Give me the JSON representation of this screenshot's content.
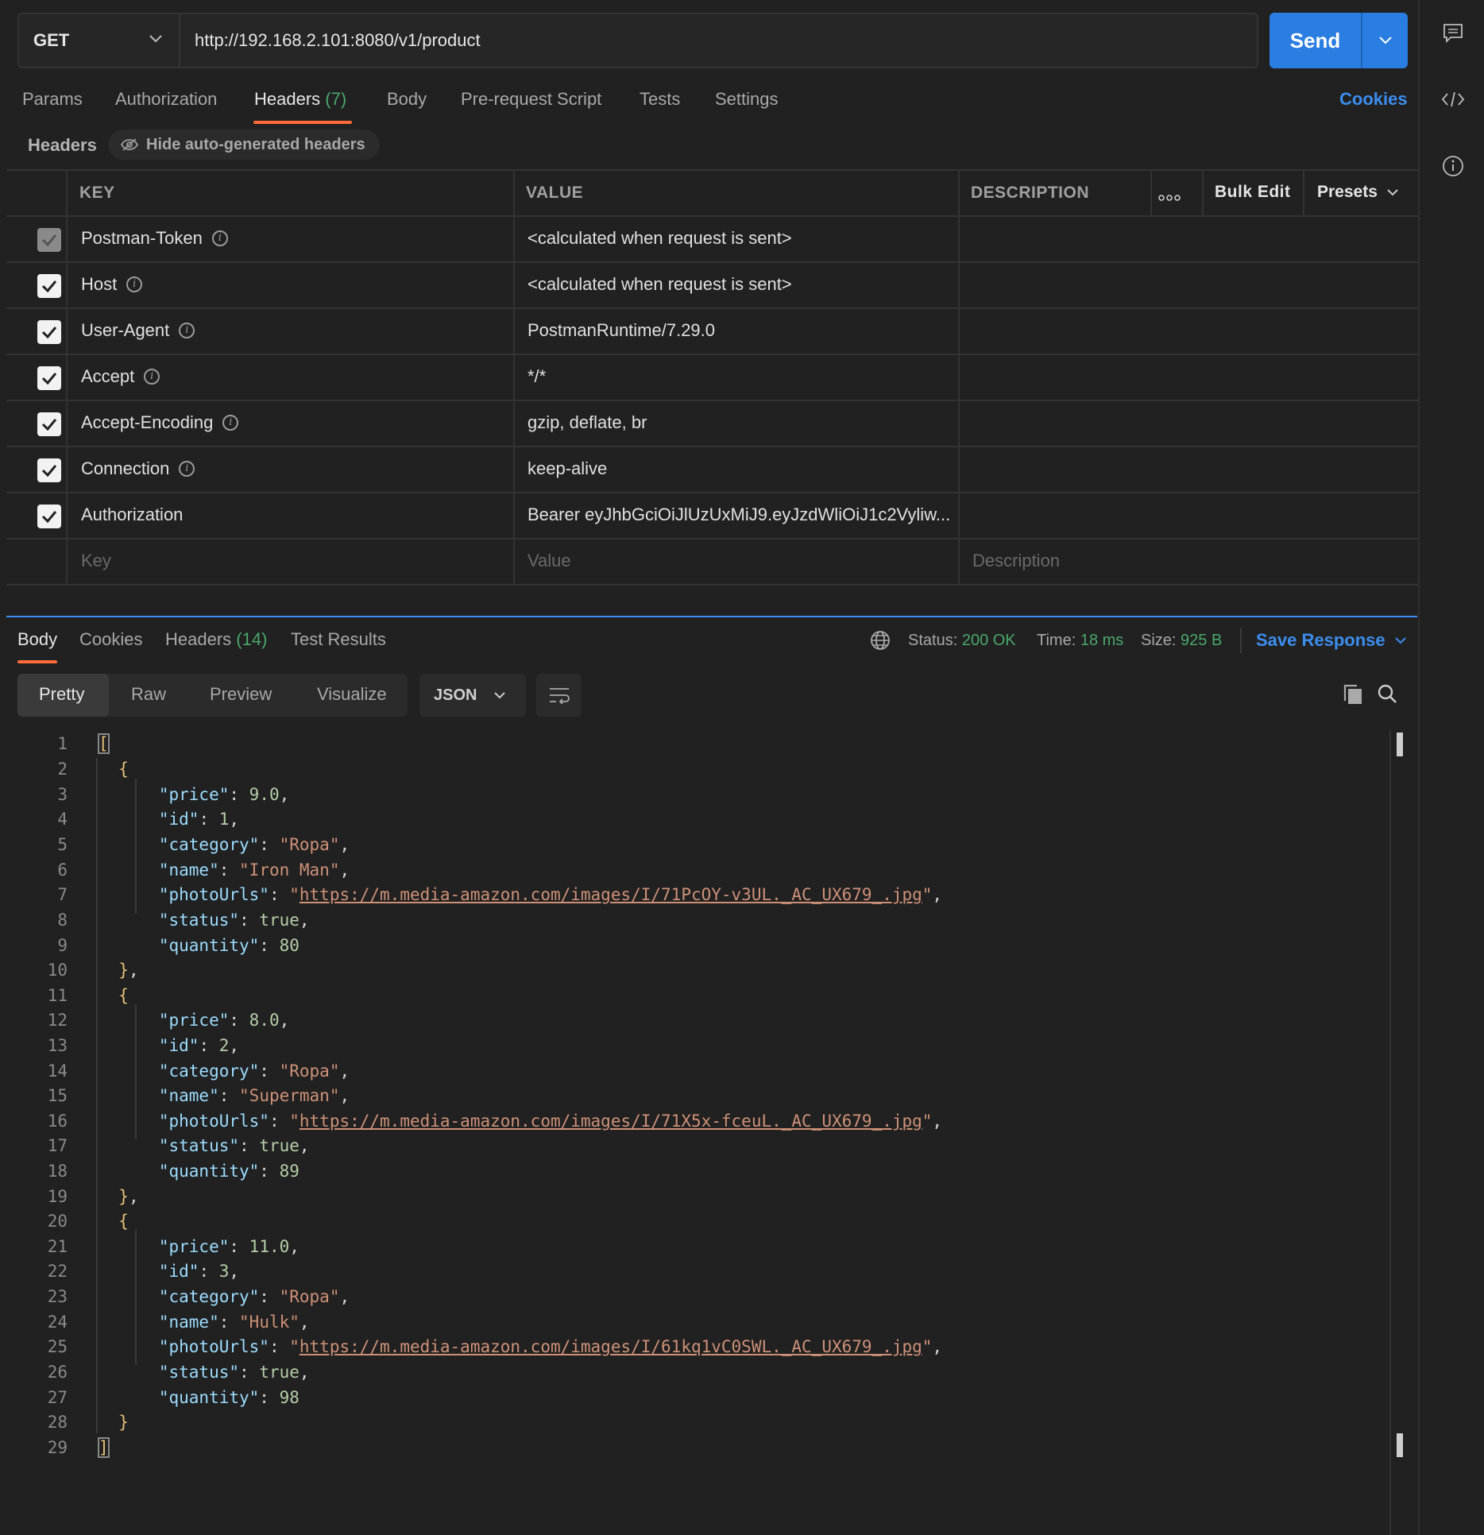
{
  "request": {
    "method": "GET",
    "url": "http://192.168.2.101:8080/v1/product",
    "send_label": "Send"
  },
  "request_tabs": {
    "params": "Params",
    "authorization": "Authorization",
    "headers": "Headers",
    "headers_count": "(7)",
    "body": "Body",
    "prerequest": "Pre-request Script",
    "tests": "Tests",
    "settings": "Settings",
    "cookies": "Cookies"
  },
  "headers_section": {
    "title": "Headers",
    "hide_auto": "Hide auto-generated headers",
    "col_key": "KEY",
    "col_value": "VALUE",
    "col_description": "DESCRIPTION",
    "bulk_edit": "Bulk Edit",
    "presets": "Presets",
    "rows": [
      {
        "key": "Postman-Token",
        "value": "<calculated when request is sent>"
      },
      {
        "key": "Host",
        "value": "<calculated when request is sent>"
      },
      {
        "key": "User-Agent",
        "value": "PostmanRuntime/7.29.0"
      },
      {
        "key": "Accept",
        "value": "*/*"
      },
      {
        "key": "Accept-Encoding",
        "value": "gzip, deflate, br"
      },
      {
        "key": "Connection",
        "value": "keep-alive"
      },
      {
        "key": "Authorization",
        "value": "Bearer eyJhbGciOiJlUzUxMiJ9.eyJzdWliOiJ1c2Vyliw..."
      }
    ],
    "placeholder_key": "Key",
    "placeholder_value": "Value",
    "placeholder_description": "Description"
  },
  "response_tabs": {
    "body": "Body",
    "cookies": "Cookies",
    "headers": "Headers",
    "headers_count": "(14)",
    "test_results": "Test Results"
  },
  "response_status": {
    "status_label": "Status:",
    "status_value": "200 OK",
    "time_label": "Time:",
    "time_value": "18 ms",
    "size_label": "Size:",
    "size_value": "925 B",
    "save_response": "Save Response"
  },
  "view_modes": {
    "pretty": "Pretty",
    "raw": "Raw",
    "preview": "Preview",
    "visualize": "Visualize",
    "format": "JSON"
  },
  "products": [
    {
      "price": "9.0",
      "id": "1",
      "category": "Ropa",
      "name": "Iron Man",
      "photoUrls": "https://m.media-amazon.com/images/I/71PcOY-v3UL._AC_UX679_.jpg",
      "status": "true",
      "quantity": "80"
    },
    {
      "price": "8.0",
      "id": "2",
      "category": "Ropa",
      "name": "Superman",
      "photoUrls": "https://m.media-amazon.com/images/I/71X5x-fceuL._AC_UX679_.jpg",
      "status": "true",
      "quantity": "89"
    },
    {
      "price": "11.0",
      "id": "3",
      "category": "Ropa",
      "name": "Hulk",
      "photoUrls": "https://m.media-amazon.com/images/I/61kq1vC0SWL._AC_UX679_.jpg",
      "status": "true",
      "quantity": "98"
    }
  ],
  "colors": {
    "accent": "#ff6c37",
    "link": "#3b8ef0",
    "send": "#2a7de1",
    "success": "#49a86b"
  }
}
